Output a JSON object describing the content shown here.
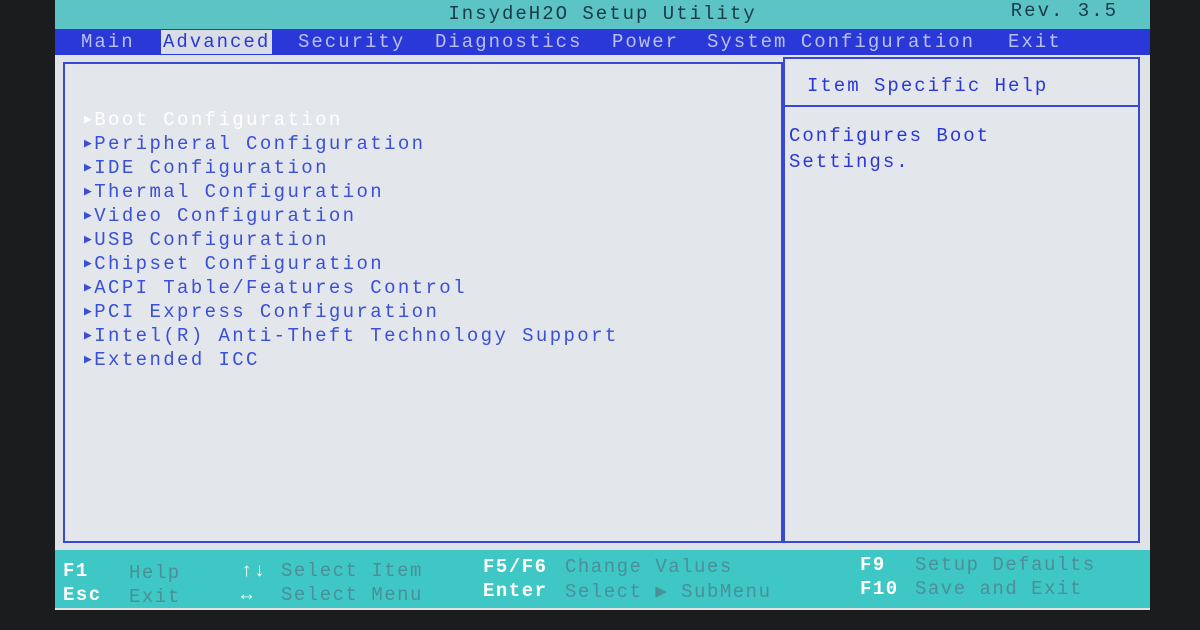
{
  "header": {
    "title": "InsydeH2O Setup Utility",
    "revision": "Rev. 3.5"
  },
  "tabs": [
    {
      "label": "Main",
      "selected": false
    },
    {
      "label": "Advanced",
      "selected": true
    },
    {
      "label": "Security",
      "selected": false
    },
    {
      "label": "Diagnostics",
      "selected": false
    },
    {
      "label": "Power",
      "selected": false
    },
    {
      "label": "System Configuration",
      "selected": false
    },
    {
      "label": "Exit",
      "selected": false
    }
  ],
  "menu": {
    "selected_index": 0,
    "items": [
      "Boot Configuration",
      "Peripheral Configuration",
      "IDE Configuration",
      "Thermal Configuration",
      "Video Configuration",
      "USB Configuration",
      "Chipset Configuration",
      "ACPI Table/Features Control",
      "PCI Express Configuration",
      "Intel(R) Anti-Theft Technology Support",
      "Extended ICC"
    ]
  },
  "help": {
    "title": "Item Specific Help",
    "text": "Configures Boot\nSettings."
  },
  "footer": [
    {
      "key": "F1",
      "desc": "Help"
    },
    {
      "key": "Esc",
      "desc": "Exit"
    },
    {
      "key": "↑↓",
      "desc": "Select Item"
    },
    {
      "key": "↔",
      "desc": "Select Menu"
    },
    {
      "key": "F5/F6",
      "desc": "Change Values"
    },
    {
      "key": "Enter",
      "desc": "Select ▶ SubMenu"
    },
    {
      "key": "F9",
      "desc": "Setup Defaults"
    },
    {
      "key": "F10",
      "desc": "Save and Exit"
    }
  ],
  "colors": {
    "title_bar": "#5cc4c4",
    "tab_bar": "#2a38d8",
    "panel_bg": "#e3e6ea",
    "item_text": "#3a50d8",
    "footer_bg": "#3ec7c4"
  }
}
